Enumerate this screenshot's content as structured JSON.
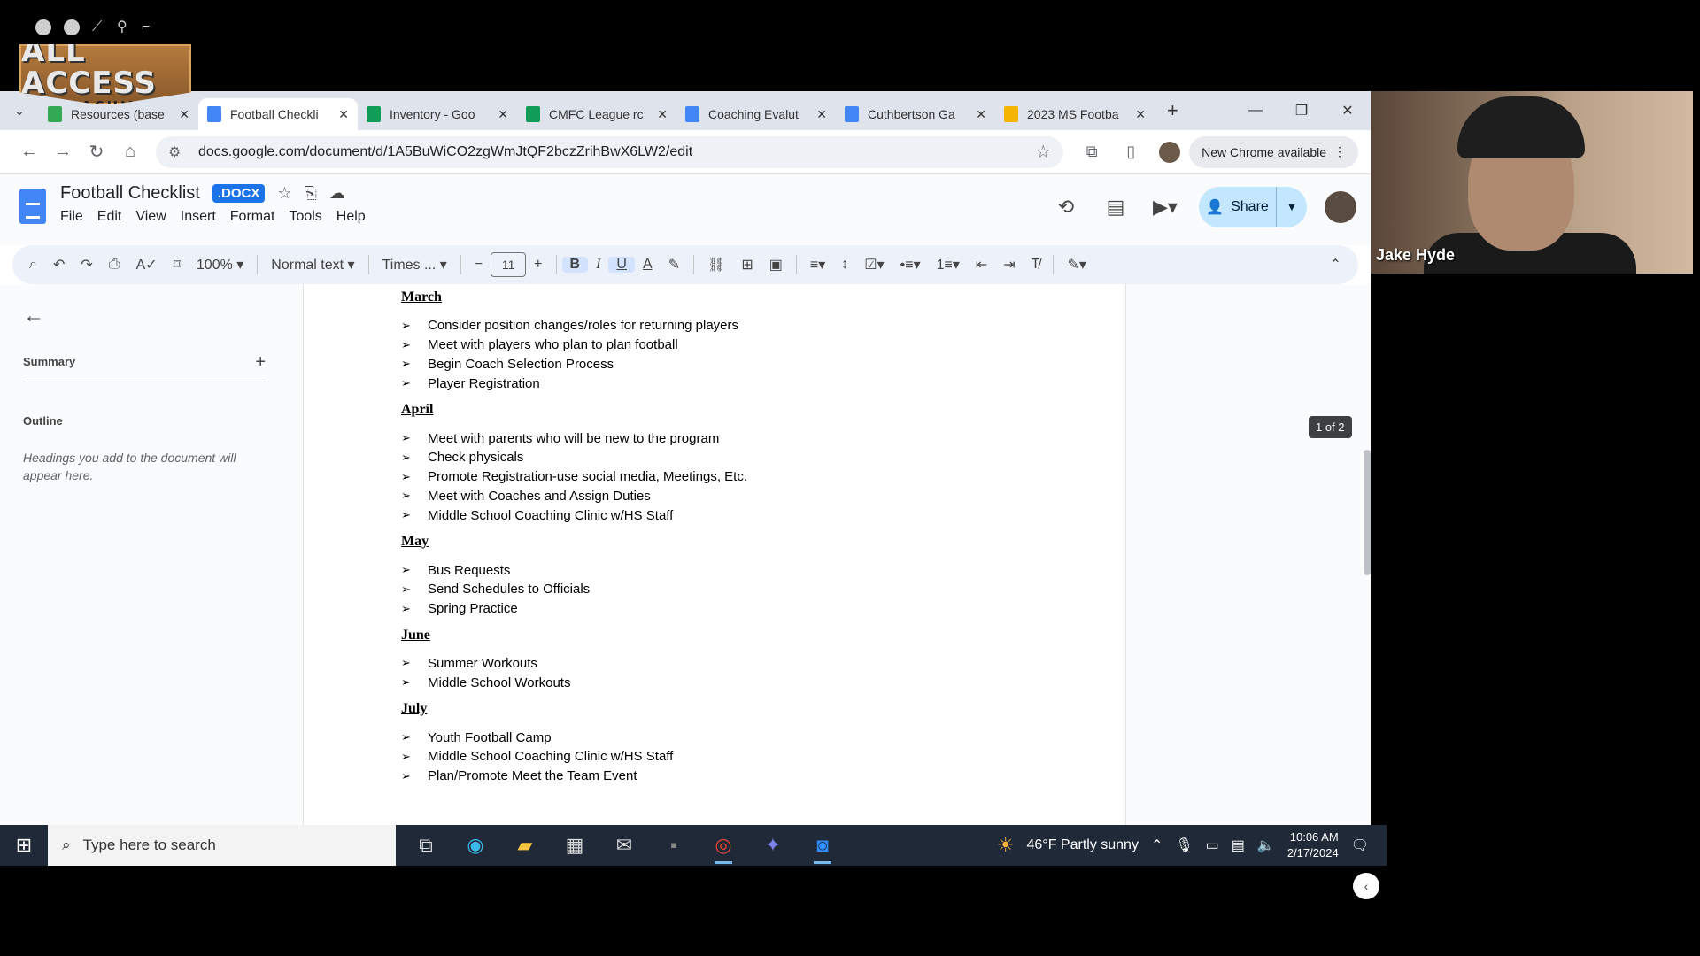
{
  "logo": {
    "title": "ALL ACCESS",
    "subtitle": "COACHING"
  },
  "tabs": [
    {
      "label": "Resources (base",
      "color": "#34a853",
      "active": false
    },
    {
      "label": "Football Checkli",
      "color": "#4285f4",
      "active": true
    },
    {
      "label": "Inventory - Goo",
      "color": "#0f9d58",
      "active": false
    },
    {
      "label": "CMFC League rc",
      "color": "#0f9d58",
      "active": false
    },
    {
      "label": "Coaching Evalut",
      "color": "#4285f4",
      "active": false
    },
    {
      "label": "Cuthbertson Ga",
      "color": "#4285f4",
      "active": false
    },
    {
      "label": "2023 MS Footba",
      "color": "#f4b400",
      "active": false
    }
  ],
  "toolbar": {
    "url": "docs.google.com/document/d/1A5BuWiCO2zgWmJtQF2bczZrihBwX6LW2/edit",
    "new_chrome": "New Chrome available"
  },
  "doc": {
    "title": "Football Checklist",
    "badge": ".DOCX",
    "menu": [
      "File",
      "Edit",
      "View",
      "Insert",
      "Format",
      "Tools",
      "Help"
    ],
    "share": "Share"
  },
  "format_bar": {
    "zoom": "100%",
    "style": "Normal text",
    "font": "Times ...",
    "font_size": "11"
  },
  "outline": {
    "summary": "Summary",
    "outline_title": "Outline",
    "hint": "Headings you add to the document will appear here."
  },
  "content": [
    {
      "month": "March",
      "items": [
        "Consider position changes/roles for returning players",
        "Meet with players who plan to plan football",
        "Begin Coach Selection Process",
        "Player Registration"
      ]
    },
    {
      "month": "April",
      "items": [
        "Meet with parents who will be new to the program",
        "Check physicals",
        "Promote Registration-use social media, Meetings, Etc.",
        "Meet with Coaches and Assign Duties",
        "Middle School Coaching Clinic w/HS Staff"
      ]
    },
    {
      "month": "May",
      "items": [
        "Bus Requests",
        "Send Schedules to Officials",
        "Spring Practice"
      ]
    },
    {
      "month": "June",
      "items": [
        "Summer Workouts",
        "Middle School Workouts"
      ]
    },
    {
      "month": "July",
      "items": [
        "Youth Football Camp",
        "Middle School Coaching Clinic w/HS Staff",
        "Plan/Promote Meet the Team Event"
      ]
    }
  ],
  "page_count": "1 of 2",
  "webcam": {
    "name": "Jake Hyde"
  },
  "taskbar": {
    "search_placeholder": "Type here to search",
    "weather": "46°F  Partly sunny",
    "time": "10:06 AM",
    "date": "2/17/2024"
  }
}
